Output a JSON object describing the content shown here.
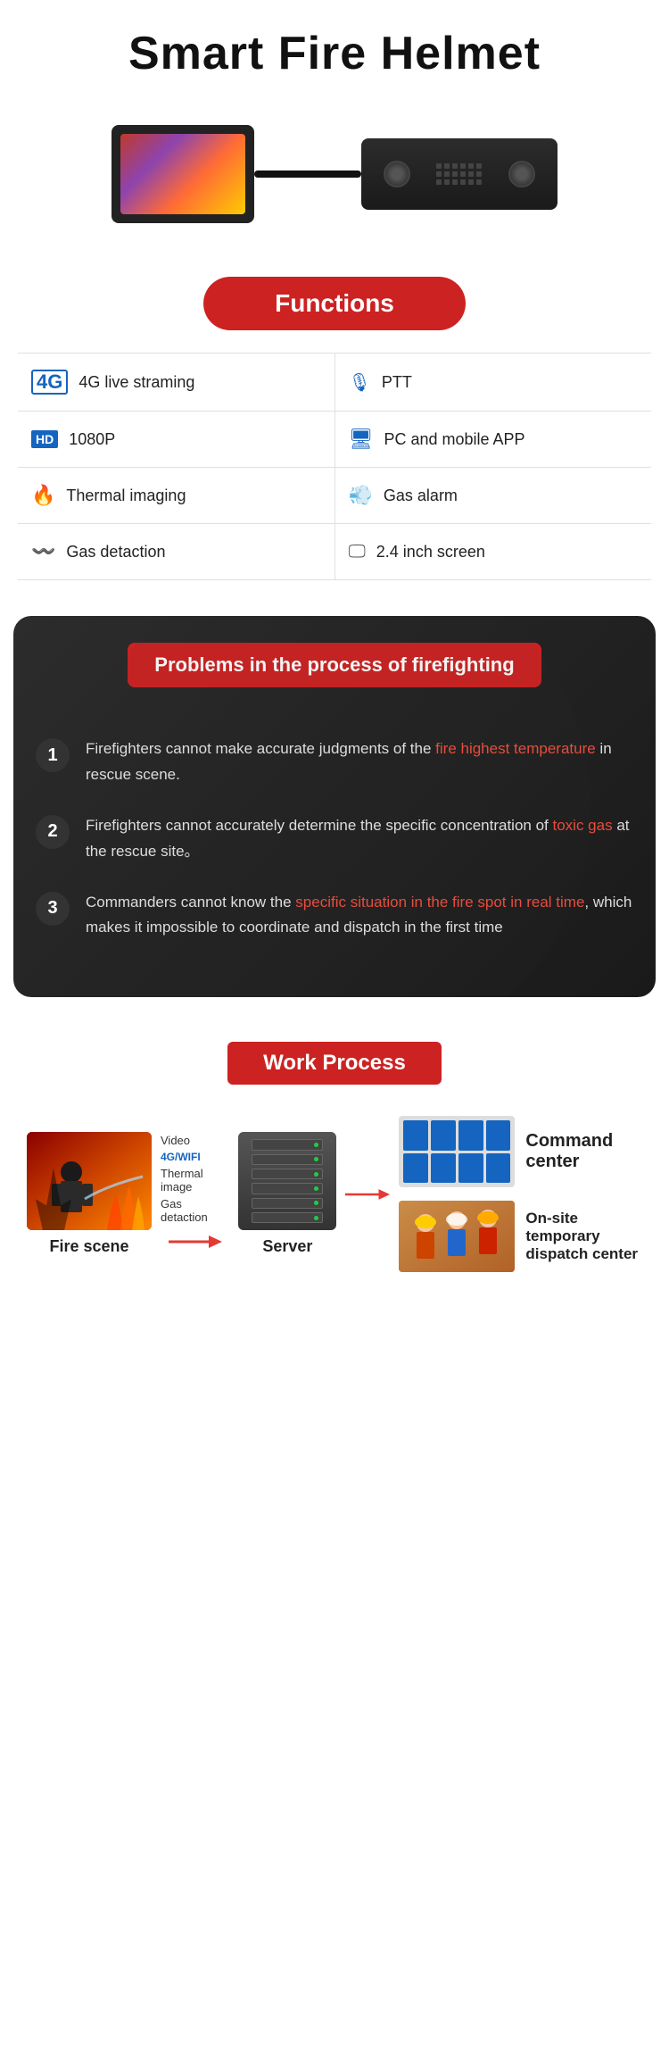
{
  "header": {
    "title": "Smart Fire  Helmet"
  },
  "functions_btn": "Functions",
  "features": [
    {
      "left": {
        "icon": "4g-icon",
        "label": "4G live straming"
      },
      "right": {
        "icon": "mic-icon",
        "label": "PTT"
      }
    },
    {
      "left": {
        "icon": "hd-icon",
        "label": "1080P"
      },
      "right": {
        "icon": "monitor-icon",
        "label": "PC and mobile APP"
      }
    },
    {
      "left": {
        "icon": "thermal-icon",
        "label": "Thermal imaging"
      },
      "right": {
        "icon": "wind-icon",
        "label": "Gas alarm"
      }
    },
    {
      "left": {
        "icon": "gas-icon",
        "label": "Gas detaction"
      },
      "right": {
        "icon": "screen-icon",
        "label": "2.4 inch screen"
      }
    }
  ],
  "problems": {
    "section_title": "Problems in the process of firefighting",
    "items": [
      {
        "number": "1",
        "text_before": "Firefighters cannot make accurate judgments of the ",
        "highlight": "fire highest temperature",
        "text_after": " in rescue scene."
      },
      {
        "number": "2",
        "text_before": "Firefighters cannot accurately determine the specific concentration of ",
        "highlight": "toxic gas",
        "text_after": " at the rescue site。"
      },
      {
        "number": "3",
        "text_before": "Commanders cannot know the ",
        "highlight": "specific situation in the fire spot in real time",
        "text_after": ", which makes it impossible to coordinate and dispatch in the first time"
      }
    ]
  },
  "work_process": {
    "title": "Work Process",
    "nodes": {
      "fire_scene": "Fire scene",
      "server": "Server",
      "command_center": "Command center",
      "dispatch_center": "On-site temporary dispatch center"
    },
    "data_labels": {
      "video": "Video",
      "wifi": "4G/WIFI",
      "thermal": "Thermal image",
      "gas": "Gas detaction"
    }
  }
}
